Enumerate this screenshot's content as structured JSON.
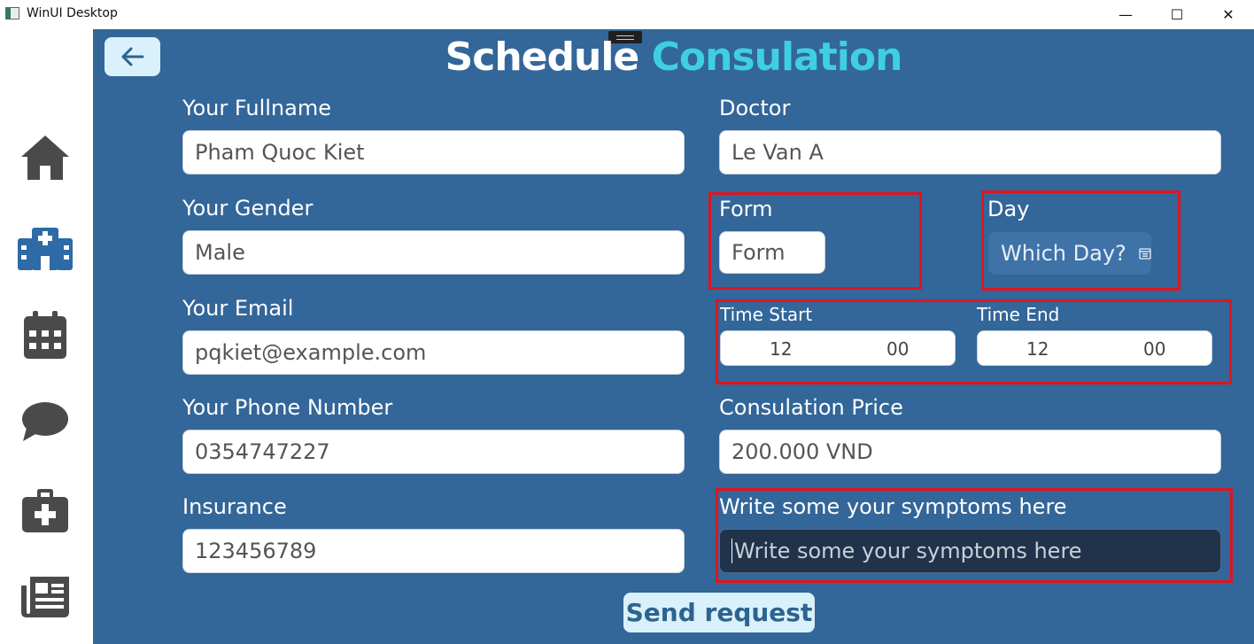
{
  "window": {
    "title": "WinUI Desktop",
    "minimize_glyph": "—",
    "maximize_glyph": "☐",
    "close_glyph": "✕"
  },
  "sidebar": {
    "items": [
      {
        "icon": "home-icon"
      },
      {
        "icon": "hospital-icon"
      },
      {
        "icon": "calendar-icon"
      },
      {
        "icon": "chat-icon"
      },
      {
        "icon": "medical-kit-icon"
      },
      {
        "icon": "newspaper-icon"
      }
    ]
  },
  "header": {
    "back_icon": "arrow-left-icon",
    "title_part1": "Schedule",
    "title_part2": "Consulation"
  },
  "form": {
    "fullname": {
      "label": "Your Fullname",
      "value": "Pham Quoc Kiet"
    },
    "gender": {
      "label": "Your Gender",
      "value": "Male"
    },
    "email": {
      "label": "Your Email",
      "value": "pqkiet@example.com"
    },
    "phone": {
      "label": "Your Phone Number",
      "value": "0354747227"
    },
    "insurance": {
      "label": "Insurance",
      "value": "123456789"
    },
    "doctor": {
      "label": "Doctor",
      "value": "Le Van A"
    },
    "form_type": {
      "label": "Form",
      "placeholder": "Form"
    },
    "day": {
      "label": "Day",
      "placeholder": "Which Day?"
    },
    "time_start": {
      "label": "Time Start",
      "hour": "12",
      "minute": "00"
    },
    "time_end": {
      "label": "Time End",
      "hour": "12",
      "minute": "00"
    },
    "price": {
      "label": "Consulation Price",
      "value": "200.000 VND"
    },
    "symptoms": {
      "label": "Write some your symptoms here",
      "placeholder": "Write some your symptoms here"
    },
    "submit_label": "Send request"
  },
  "colors": {
    "background": "#336699",
    "title_accent": "#3ed0e0",
    "button_bg": "#d9f1fa",
    "highlight": "#e0141e"
  }
}
